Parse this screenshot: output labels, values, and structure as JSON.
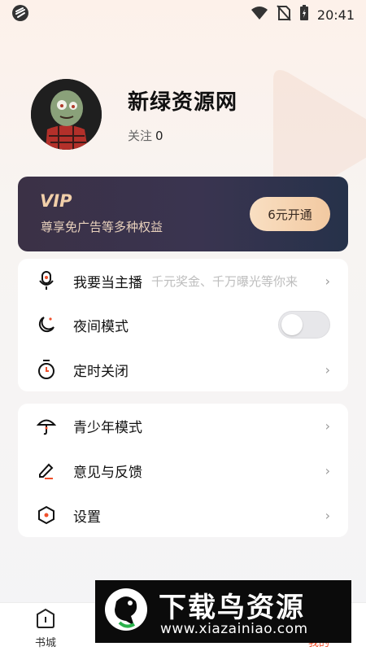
{
  "status_bar": {
    "time": "20:41"
  },
  "profile": {
    "username": "新绿资源网",
    "follow_label": "关注",
    "follow_count": "0"
  },
  "vip": {
    "logo_text": "VIP",
    "description": "尊享免广告等多种权益",
    "button_label": "6元开通"
  },
  "menu_group1": [
    {
      "label": "我要当主播",
      "subtitle": "千元奖金、千万曝光等你来",
      "icon": "microphone-icon",
      "control": "chevron"
    },
    {
      "label": "夜间模式",
      "icon": "moon-icon",
      "control": "toggle",
      "toggle_on": false
    },
    {
      "label": "定时关闭",
      "icon": "stopwatch-icon",
      "control": "chevron"
    }
  ],
  "menu_group2": [
    {
      "label": "青少年模式",
      "icon": "umbrella-icon",
      "control": "chevron"
    },
    {
      "label": "意见与反馈",
      "icon": "pen-icon",
      "control": "chevron"
    },
    {
      "label": "设置",
      "icon": "hexagon-settings-icon",
      "control": "chevron"
    }
  ],
  "tabs": [
    {
      "label": "书城",
      "icon": "bookstore-icon"
    },
    {
      "label": "我的",
      "icon": "profile-icon",
      "active": true
    }
  ],
  "watermark": {
    "title": "下载鸟资源",
    "url": "www.xiazainiao.com"
  },
  "colors": {
    "accent": "#f0502c",
    "vip_gold": "#e9d2bd"
  }
}
